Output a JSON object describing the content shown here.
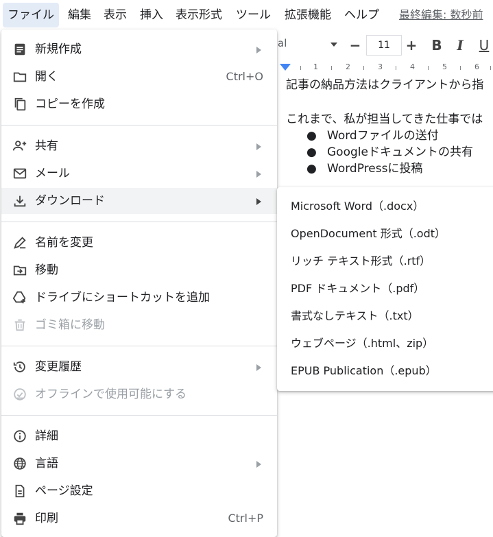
{
  "menubar": {
    "items": [
      "ファイル",
      "編集",
      "表示",
      "挿入",
      "表示形式",
      "ツール",
      "拡張機能",
      "ヘルプ"
    ],
    "last_edit": "最終編集: 数秒前"
  },
  "toolbar": {
    "font_name": "al",
    "font_size": "11",
    "minus": "−",
    "plus": "+",
    "bold": "B",
    "italic": "I",
    "underline": "U"
  },
  "ruler": {
    "numbers": [
      "1",
      "2",
      "3",
      "4",
      "5",
      "6"
    ]
  },
  "document": {
    "line1": "記事の納品方法はクライアントから指",
    "line2": "これまで、私が担当してきた仕事では",
    "bullet_char": "●",
    "bullets": [
      "Wordファイルの送付",
      "Googleドキュメントの共有",
      "WordPressに投稿"
    ]
  },
  "file_menu": {
    "items": [
      {
        "label": "新規作成",
        "icon": "document-icon",
        "submenu": true
      },
      {
        "label": "開く",
        "icon": "folder-icon",
        "shortcut": "Ctrl+O"
      },
      {
        "label": "コピーを作成",
        "icon": "copy-icon"
      },
      {
        "label": "共有",
        "icon": "person-add-icon",
        "submenu": true
      },
      {
        "label": "メール",
        "icon": "mail-icon",
        "submenu": true
      },
      {
        "label": "ダウンロード",
        "icon": "download-icon",
        "submenu": true
      },
      {
        "label": "名前を変更",
        "icon": "rename-icon"
      },
      {
        "label": "移動",
        "icon": "move-folder-icon"
      },
      {
        "label": "ドライブにショートカットを追加",
        "icon": "drive-add-icon"
      },
      {
        "label": "ゴミ箱に移動",
        "icon": "trash-icon",
        "disabled": true
      },
      {
        "label": "変更履歴",
        "icon": "history-icon",
        "submenu": true
      },
      {
        "label": "オフラインで使用可能にする",
        "icon": "offline-check-icon",
        "disabled": true
      },
      {
        "label": "詳細",
        "icon": "info-icon"
      },
      {
        "label": "言語",
        "icon": "globe-icon",
        "submenu": true
      },
      {
        "label": "ページ設定",
        "icon": "page-settings-icon"
      },
      {
        "label": "印刷",
        "icon": "printer-icon",
        "shortcut": "Ctrl+P"
      }
    ]
  },
  "download_submenu": {
    "items": [
      "Microsoft Word（.docx）",
      "OpenDocument 形式（.odt）",
      "リッチ テキスト形式（.rtf）",
      "PDF ドキュメント（.pdf）",
      "書式なしテキスト（.txt）",
      "ウェブページ（.html、zip）",
      "EPUB Publication（.epub）"
    ]
  },
  "colors": {
    "active_menu_bg": "#e3ebf7",
    "hover_bg": "#f1f3f4",
    "ruler_marker": "#4285f4",
    "disabled_text": "#9aa0a6"
  }
}
